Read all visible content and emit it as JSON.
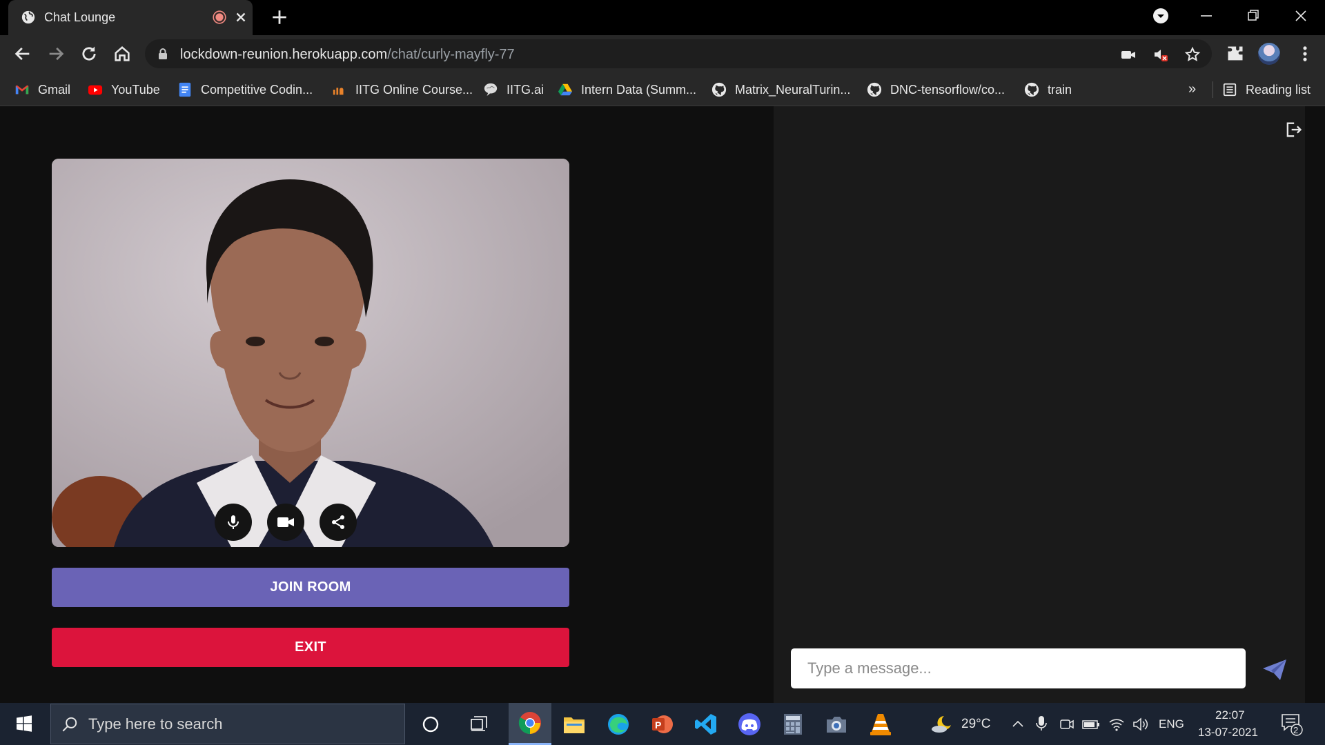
{
  "tab": {
    "title": "Chat Lounge"
  },
  "omnibox": {
    "host": "lockdown-reunion.herokuapp.com",
    "path": "/chat/curly-mayfly-77"
  },
  "bookmarks": [
    {
      "label": "Gmail",
      "icon": "gmail-icon"
    },
    {
      "label": "YouTube",
      "icon": "youtube-icon"
    },
    {
      "label": "Competitive Codin...",
      "icon": "docs-icon"
    },
    {
      "label": "IITG Online Course...",
      "icon": "course-icon"
    },
    {
      "label": "IITG.ai",
      "icon": "brain-icon"
    },
    {
      "label": "Intern Data (Summ...",
      "icon": "drive-icon"
    },
    {
      "label": "Matrix_NeuralTurin...",
      "icon": "github-icon"
    },
    {
      "label": "DNC-tensorflow/co...",
      "icon": "github-icon"
    },
    {
      "label": "train",
      "icon": "github-icon"
    }
  ],
  "bookmarks_more": "»",
  "reading_list": "Reading list",
  "buttons": {
    "join": "JOIN ROOM",
    "exit": "EXIT"
  },
  "chat": {
    "placeholder": "Type a message..."
  },
  "taskbar": {
    "search_placeholder": "Type here to search",
    "weather": "29°C",
    "language": "ENG",
    "time": "22:07",
    "date": "13-07-2021",
    "notifications": "2"
  },
  "colors": {
    "join": "#6a63b6",
    "exit": "#dc143c",
    "send": "#6f7fd0"
  }
}
